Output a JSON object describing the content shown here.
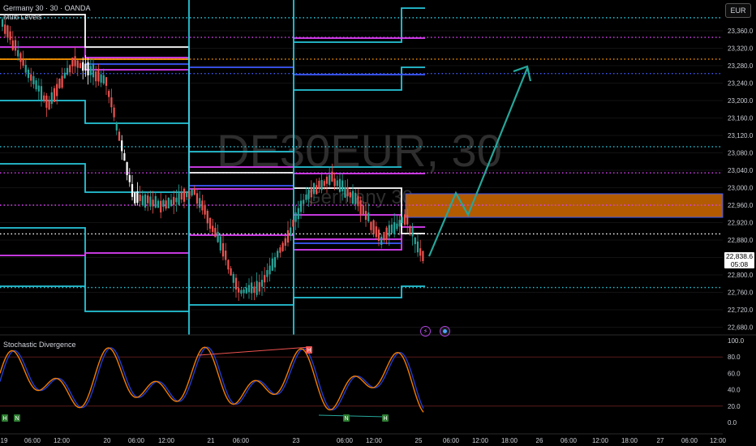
{
  "header": {
    "symbol_line": "Germany 30 · 30 · OANDA",
    "indicator_label": "Multi Levels"
  },
  "currency_label": "EUR",
  "watermark": {
    "symbol": "DE30EUR, 30",
    "name": "Germany 30"
  },
  "current_price": {
    "value": "22,838.6",
    "countdown": "05:08"
  },
  "oscillator": {
    "title": "Stochastic Divergence"
  },
  "icons": {
    "alert": "lightning-icon",
    "settings": "target-icon"
  },
  "colors": {
    "background": "#000000",
    "white": "#ffffff",
    "cyan": "#26c6da",
    "magenta": "#e040fb",
    "blue": "#3d5afe",
    "orange": "#ff9800",
    "zone_fill": "#b25b00",
    "projection": "#26a69a",
    "candle_up": "#26a69a",
    "candle_down": "#ef5350",
    "stoch_k": "#1e3fd0",
    "stoch_d": "#f57c00"
  },
  "chart_data": [
    {
      "type": "candlestick",
      "title": "DE30EUR, 30",
      "y_axis": {
        "ticks": [
          "23,360.0",
          "23,320.0",
          "23,280.0",
          "23,240.0",
          "23,200.0",
          "23,160.0",
          "23,120.0",
          "23,080.0",
          "23,040.0",
          "23,000.0",
          "22,960.0",
          "22,920.0",
          "22,880.0",
          "22,840.0",
          "22,800.0",
          "22,760.0",
          "22,720.0",
          "22,680.0"
        ],
        "range": [
          22660,
          23400
        ]
      },
      "x_axis": {
        "ticks": [
          "19",
          "06:00",
          "12:00",
          "20",
          "06:00",
          "12:00",
          "21",
          "06:00",
          "23",
          "06:00",
          "12:00",
          "25",
          "06:00",
          "12:00",
          "18:00",
          "26",
          "06:00",
          "12:00",
          "18:00",
          "27",
          "06:00",
          "12:00"
        ]
      },
      "dotted_levels": [
        {
          "price": 23390,
          "color": "cyan"
        },
        {
          "price": 23345,
          "color": "magenta"
        },
        {
          "price": 23295,
          "color": "orange"
        },
        {
          "price": 23262,
          "color": "blue"
        },
        {
          "price": 23094,
          "color": "cyan"
        },
        {
          "price": 23034,
          "color": "magenta"
        },
        {
          "price": 22960,
          "color": "magenta"
        },
        {
          "price": 22894,
          "color": "white"
        },
        {
          "price": 22771,
          "color": "cyan"
        }
      ],
      "zone": {
        "from": 22930,
        "to": 22988
      },
      "projection_path": [
        {
          "x_time": "25 01:00",
          "price": 22845
        },
        {
          "x_time": "25 12:00",
          "price": 22975
        },
        {
          "x_time": "25 18:00",
          "price": 22945
        },
        {
          "x_time": "26 06:00",
          "price": 23285
        }
      ],
      "last_price": 22838.6
    },
    {
      "type": "line",
      "title": "Stochastic Divergence",
      "y_axis": {
        "ticks": [
          "100.0",
          "80.0",
          "60.0",
          "40.0",
          "20.0",
          "0.0"
        ],
        "range": [
          0,
          100
        ]
      },
      "series": [
        {
          "color": "blue"
        },
        {
          "color": "orange"
        }
      ],
      "markers": [
        {
          "label": "H",
          "kind": "bullish"
        },
        {
          "label": "N",
          "kind": "bullish"
        },
        {
          "label": "H",
          "kind": "bearish"
        },
        {
          "label": "N",
          "kind": "bullish"
        },
        {
          "label": "H",
          "kind": "bullish"
        }
      ]
    }
  ]
}
